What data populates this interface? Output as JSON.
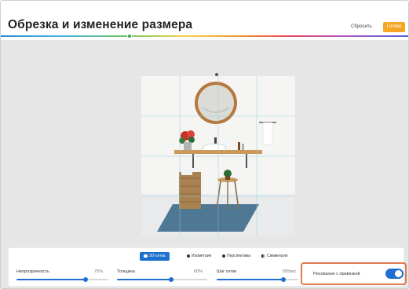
{
  "header": {
    "title": "Обрезка и изменение размера",
    "reset_label": "Сбросить",
    "done_label": "Готово"
  },
  "grid_modes": [
    {
      "label": "2D-сетка",
      "icon": "grid-2d-icon",
      "active": true
    },
    {
      "label": "Изометрия",
      "icon": "isometric-icon",
      "active": false
    },
    {
      "label": "Перспектива",
      "icon": "perspective-icon",
      "active": false
    },
    {
      "label": "Симметрия",
      "icon": "symmetry-icon",
      "active": false
    }
  ],
  "sliders": {
    "opacity": {
      "label": "Непрозрачность",
      "value_text": "75%",
      "fraction": 0.75
    },
    "thickness": {
      "label": "Толщина",
      "value_text": "60%",
      "fraction": 0.6
    },
    "grid_step": {
      "label": "Шаг сетки",
      "value_text": "555пкс",
      "fraction": 0.82
    }
  },
  "snap": {
    "label": "Рисование с привязкой",
    "enabled": true
  },
  "colors": {
    "accent": "#1f6fcf",
    "done_button": "#f5a623",
    "highlight": "#e07a4f",
    "rug": "#4f7894",
    "wood": "#c99a5b"
  }
}
